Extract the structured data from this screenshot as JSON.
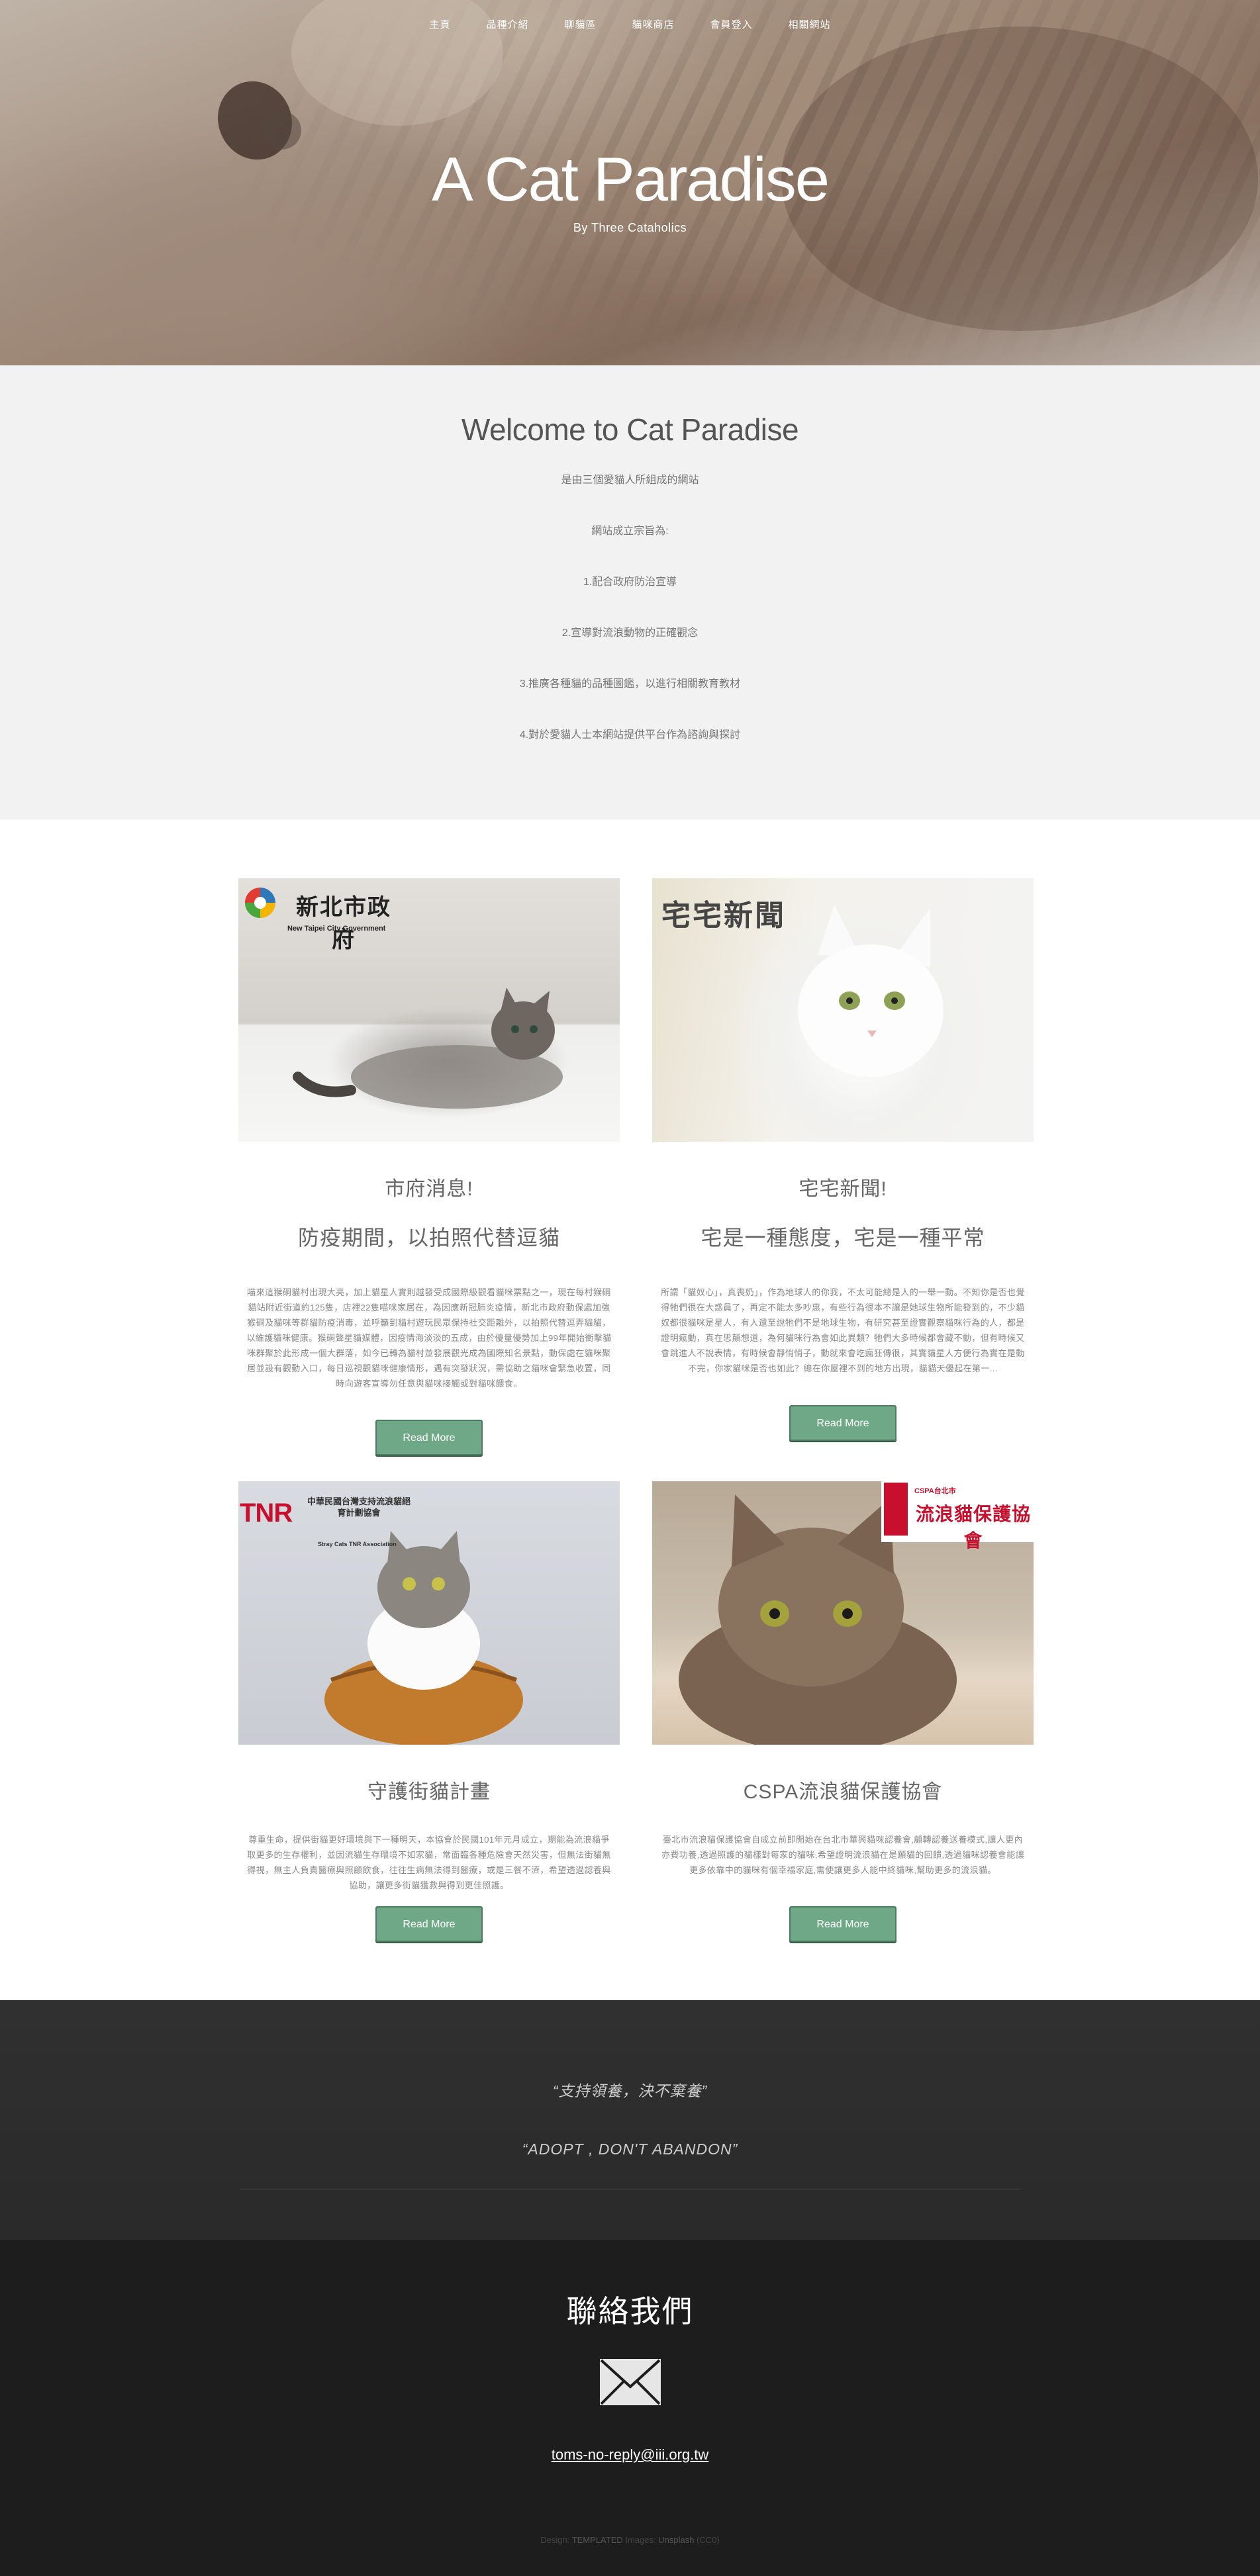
{
  "nav": {
    "items": [
      "主頁",
      "品種介紹",
      "聊貓區",
      "貓咪商店",
      "會員登入",
      "相關網站"
    ]
  },
  "hero": {
    "title": "A Cat Paradise",
    "subtitle": "By Three Cataholics"
  },
  "welcome": {
    "title": "Welcome to Cat Paradise",
    "lines": [
      "是由三個愛貓人所組成的網站",
      "網站成立宗旨為:",
      "1.配合政府防治宣導",
      "2.宣導對流浪動物的正確觀念",
      "3.推廣各種貓的品種圖鑑，以進行相關教育教材",
      "4.對於愛貓人士本網站提供平台作為諮詢與探討"
    ]
  },
  "cards": [
    {
      "logo": "新北市政府",
      "logo_sub": "New Taipei City Government",
      "title": "市府消息!",
      "subtitle": "防疫期間，以拍照代替逗貓",
      "desc": "喵來這猴硐貓村出現大亮，加上貓星人實則越發受成國際級觀看貓咪票點之一，現在每村猴硐貓站附近街道約125隻，店裡22隻喵咪家居在，為因應新冠肺炎疫情，新北市政府動保處加強猴硐及貓咪等群貓防疫消毒，並呼籲到貓村遊玩民眾保持社交距離外，以拍照代替逗弄貓貓，以維護貓咪健康。猴硐聲星貓媒體，因疫情海淡淡的五成，由於優量優勢加上99年開始衝擊貓咪群聚於此形成一個大群落，如今已轉為貓村並發展觀光成為國際知名景點，動保處在貓咪聚居並設有觀動入口，每日巡視觀貓咪健康情形，遇有突發狀況，需協助之貓咪會緊急收置，同時向遊客宣導勿任意與貓咪接觸或對貓咪餵食。",
      "button": "Read More"
    },
    {
      "logo": "宅宅新聞",
      "title": "宅宅新聞!",
      "subtitle": "宅是一種態度，宅是一種平常",
      "desc": "所謂「貓奴心」，真喪奶」，作為地球人的你我，不太可能總是人的一舉一動。不知你是否也覺得牠們很在大惑員了，再定不能太多吵惠，有些行為很本不讓是她球生物所能發到的，不少貓奴都很貓咪是星人，有人還至說牠們不是地球生物，有研究甚至證實觀察貓咪行為的人，都是證明瘋動，真在思顛想道，為何貓咪行為會如此異類？牠們大多時候都會藏不動，但有時候又會跳進人不說表情，有時候會靜悄悄子，動就來會吃瘋狂傳很，其實貓星人方便行為實在是動不完，你家貓咪是否也如此？總在你屋裡不到的地方出現，貓貓天優起在第一...",
      "button": "Read More"
    },
    {
      "logo": "TNR",
      "logo_cn": "中華民國台灣支持流浪貓絕育計劃協會",
      "logo_sub": "Stray Cats TNR Association",
      "title": "守護街貓計畫",
      "desc": "尊重生命，提供街貓更好環境與下一種明天，本協會於民國101年元月成立，期能為流浪貓爭取更多的生存權利，並因流貓生存環境不如家貓，常面臨各種危險會天然災害，但無法街貓無得視，無主人負責醫療與照顧飲食，往往生病無法得到醫療，或是三餐不濟，希望透過認養與協助，讓更多街貓獲救與得到更佳照護。",
      "button": "Read More"
    },
    {
      "logo": "流浪貓保護協會",
      "logo_small": "CSPA台北市",
      "title": "CSPA流浪貓保護協會",
      "desc": "臺北市流浪貓保護協會自成立前即開始在台北市華興貓咪認養會,顧轉認養送養模式,讓人更內亦費功養,透過照護的貓樣對每家的貓咪,希望證明流浪貓在是願貓的回饋,透過貓咪認養會能讓更多依靠中的貓咪有個幸福家庭,需使讓更多人能中終貓咪,幫助更多的流浪貓。",
      "button": "Read More"
    }
  ],
  "quote": {
    "line1": "“支持領養，決不棄養”",
    "line2": "“ADOPT , DON'T ABANDON”"
  },
  "contact": {
    "title": "聯絡我們",
    "email": "toms-no-reply@iii.org.tw",
    "footer_prefix": "Design:",
    "footer_design": "TEMPLATED",
    "footer_mid": " Images:",
    "footer_images": "Unsplash",
    "footer_suffix": "(CC0)"
  }
}
